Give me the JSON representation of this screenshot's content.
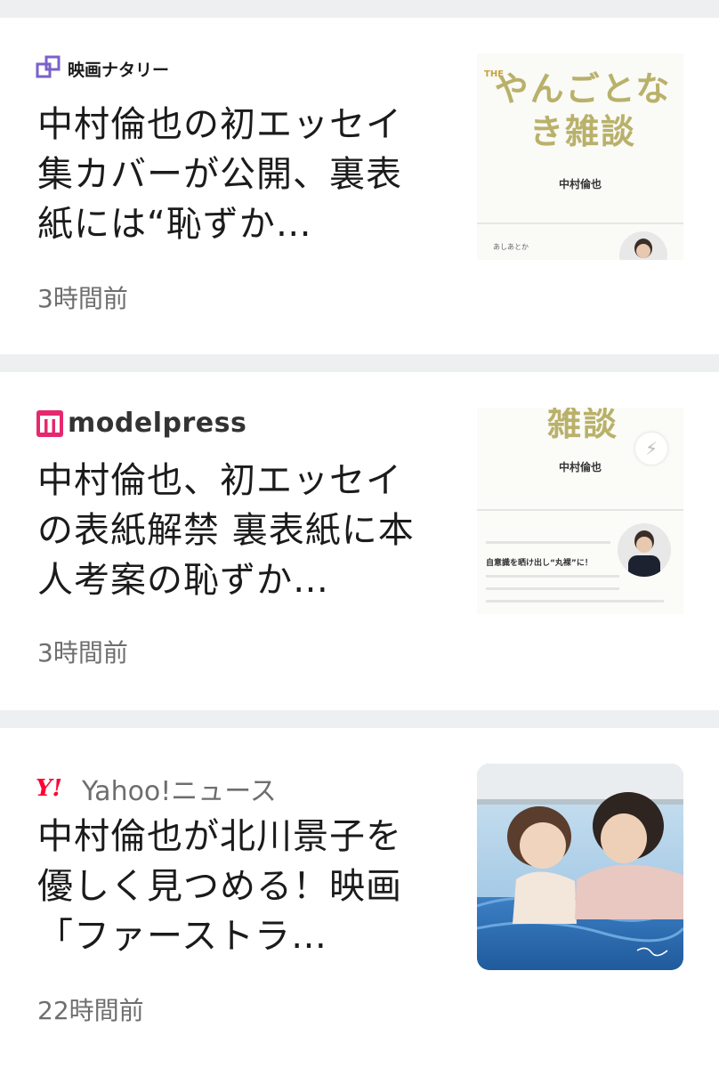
{
  "articles": [
    {
      "source": "映画ナタリー",
      "headline": "中村倫也の初エッセイ集カバーが公開、裏表紙には“恥ずか…",
      "time": "3時間前",
      "thumb": {
        "title": "やんごとなき雑談",
        "title_small": "THE",
        "author": "中村倫也",
        "text": "あしあとか"
      }
    },
    {
      "source": "modelpress",
      "headline": "中村倫也、初エッセイの表紙解禁 裏表紙に本人考案の恥ずか…",
      "time": "3時間前",
      "thumb": {
        "title": "雑談",
        "author": "中村倫也",
        "text": "自意識を晒け出し“丸裸”に！"
      }
    },
    {
      "source": "Yahoo!ニュース",
      "headline": "中村倫也が北川景子を優しく見つめる！映画「ファーストラ…",
      "time": "22時間前",
      "logo_text": "Y!"
    }
  ]
}
